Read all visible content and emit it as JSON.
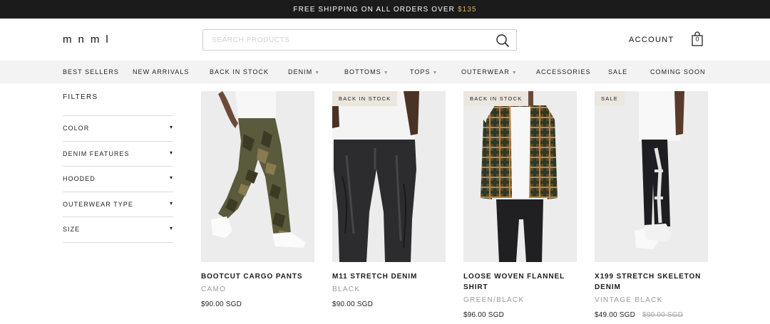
{
  "promo": {
    "text": "FREE SHIPPING ON ALL ORDERS OVER",
    "amount": "$135"
  },
  "header": {
    "logo": "mnml",
    "search_placeholder": "SEARCH PRODUCTS",
    "search_value": "",
    "account_label": "ACCOUNT",
    "cart_count": "0"
  },
  "nav": [
    {
      "label": "BEST SELLERS",
      "dropdown": false
    },
    {
      "label": "NEW ARRIVALS",
      "dropdown": false
    },
    {
      "label": "BACK IN STOCK",
      "dropdown": false
    },
    {
      "label": "DENIM",
      "dropdown": true
    },
    {
      "label": "BOTTOMS",
      "dropdown": true
    },
    {
      "label": "TOPS",
      "dropdown": true
    },
    {
      "label": "OUTERWEAR",
      "dropdown": true
    },
    {
      "label": "ACCESSORIES",
      "dropdown": false
    },
    {
      "label": "SALE",
      "dropdown": false
    },
    {
      "label": "COMING SOON",
      "dropdown": false
    }
  ],
  "filters": {
    "title": "FILTERS",
    "items": [
      {
        "label": "COLOR"
      },
      {
        "label": "DENIM FEATURES"
      },
      {
        "label": "HOODED"
      },
      {
        "label": "OUTERWEAR TYPE"
      },
      {
        "label": "SIZE"
      }
    ],
    "arrow": "▾"
  },
  "products": [
    {
      "badge": "",
      "name": "BOOTCUT CARGO PANTS",
      "color": "CAMO",
      "price": "$90.00 SGD",
      "old_price": ""
    },
    {
      "badge": "BACK IN STOCK",
      "name": "M11 STRETCH DENIM",
      "color": "BLACK",
      "price": "$90.00 SGD",
      "old_price": ""
    },
    {
      "badge": "BACK IN STOCK",
      "name": "LOOSE WOVEN FLANNEL SHIRT",
      "color": "GREEN/BLACK",
      "price": "$96.00 SGD",
      "old_price": ""
    },
    {
      "badge": "SALE",
      "name": "X199 STRETCH SKELETON DENIM",
      "color": "VINTAGE BLACK",
      "price": "$49.00 SGD",
      "old_price": "$90.00 SGD"
    }
  ],
  "colors": {
    "promo_bg": "#1b1b1b",
    "promo_accent": "#d9b25a",
    "nav_bg": "#f3f3f3",
    "badge_bg": "#ebe6de",
    "muted_text": "#9b9b9b"
  }
}
